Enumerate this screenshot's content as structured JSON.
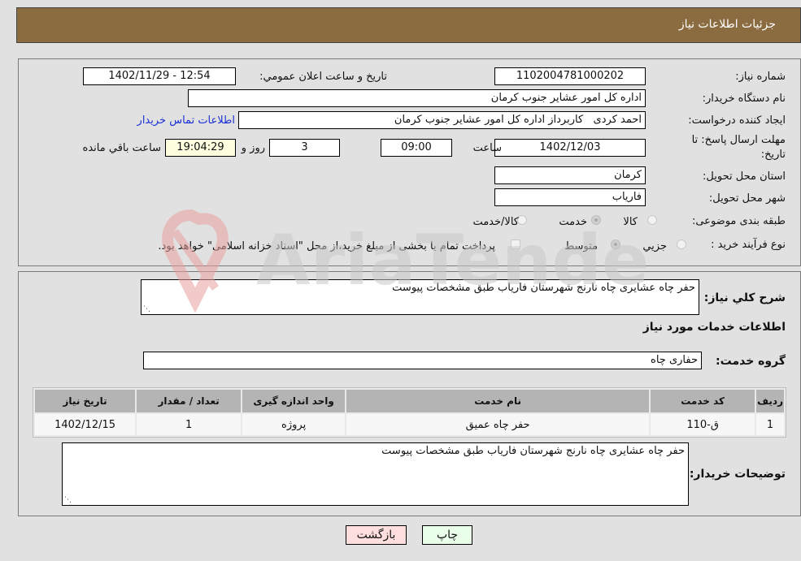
{
  "header": {
    "title": "جزئیات اطلاعات نیاز"
  },
  "details": {
    "need_number": {
      "label": "شماره نیاز:",
      "value": "1102004781000202"
    },
    "announce_datetime": {
      "label": "تاریخ و ساعت اعلان عمومي:",
      "value": "1402/11/29 - 12:54"
    },
    "buyer_org": {
      "label": "نام دستگاه خريدار:",
      "value": "اداره کل امور عشایر جنوب کرمان"
    },
    "requester": {
      "label": "ايجاد کننده درخواست:",
      "value": "احمد کردی   کاربرداز اداره کل امور عشایر جنوب کرمان"
    },
    "contact_link": "اطلاعات تماس خريدار",
    "deadline": {
      "label_line1": "مهلت ارسال پاسخ: تا",
      "label_line2": "تاريخ:",
      "date": "1402/12/03",
      "time_label": "ساعت",
      "time": "09:00",
      "days": "3",
      "days_label": "روز و",
      "remaining": "19:04:29",
      "remaining_label": "ساعت باقي مانده"
    },
    "province": {
      "label": "استان محل تحويل:",
      "value": "کرمان"
    },
    "city": {
      "label": "شهر محل تحويل:",
      "value": "فارياب"
    },
    "category": {
      "label": "طبقه بندی موضوعی:",
      "options": [
        {
          "label": "کالا",
          "selected": false
        },
        {
          "label": "خدمت",
          "selected": true
        },
        {
          "label": "کالا/خدمت",
          "selected": false
        }
      ]
    },
    "purchase_type": {
      "label": "نوع فرآيند خريد :",
      "options": [
        {
          "label": "جزيي",
          "selected": false
        },
        {
          "label": "متوسط",
          "selected": true
        }
      ],
      "payment_note": "پرداخت تمام يا بخشی از مبلغ خريد،از محل \"اسناد خزانه اسلامی\" خواهد بود.",
      "payment_checked": false
    }
  },
  "description": {
    "label": "شرح کلي نياز:",
    "value": "حفر چاه عشایری چاه نارنج شهرستان فاریاب طبق مشخصات پیوست"
  },
  "services": {
    "section_title": "اطلاعات خدمات مورد نياز",
    "group_label": "گروه خدمت:",
    "group_value": "حفاری چاه",
    "table": {
      "headers": [
        "رديف",
        "کد خدمت",
        "نام خدمت",
        "واحد اندازه گيری",
        "تعداد / مقدار",
        "تاريخ نياز"
      ],
      "rows": [
        [
          "1",
          "ق-110",
          "حفر چاه عمیق",
          "پروژه",
          "1",
          "1402/12/15"
        ]
      ]
    }
  },
  "buyer_notes": {
    "label": "توضيحات خريدار:",
    "value": "حفر چاه عشایری چاه نارنج شهرستان فاریاب طبق مشخصات پیوست"
  },
  "buttons": {
    "print": "چاپ",
    "back": "بازگشت"
  },
  "watermark": {
    "text": "AriaTender.neT"
  }
}
